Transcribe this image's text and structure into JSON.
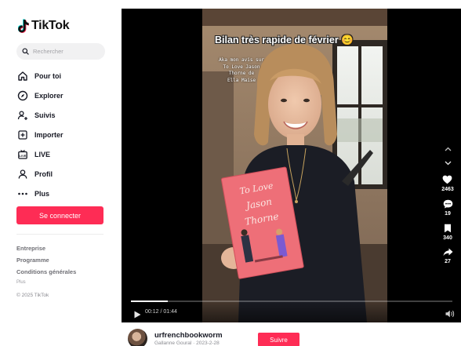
{
  "brand": {
    "name": "TikTok"
  },
  "search": {
    "placeholder": "Rechercher"
  },
  "nav": {
    "items": [
      {
        "label": "Pour toi",
        "icon": "home-icon"
      },
      {
        "label": "Explorer",
        "icon": "compass-icon"
      },
      {
        "label": "Suivis",
        "icon": "user-follow-icon"
      },
      {
        "label": "Importer",
        "icon": "upload-icon"
      },
      {
        "label": "LIVE",
        "icon": "live-tv-icon"
      },
      {
        "label": "Profil",
        "icon": "profile-icon"
      },
      {
        "label": "Plus",
        "icon": "more-icon"
      }
    ]
  },
  "sidebar": {
    "connect_label": "Se connecter",
    "footer": {
      "company": "Entreprise",
      "program": "Programme",
      "terms": "Conditions générales",
      "more": "Plus",
      "copyright": "© 2025 TikTok"
    }
  },
  "video": {
    "caption_title": "Bilan très rapide de février 😊",
    "caption_sub": "Aka mon avis sur\nTo Love Jason\nThorne de\nElla Maise",
    "book_title": "To Love Jason Thorne",
    "time": "00:12 / 01:44",
    "progress": 0.115
  },
  "actions": {
    "likes": "2463",
    "comments": "19",
    "saves": "340",
    "shares": "27"
  },
  "author": {
    "username": "urfrenchbookworm",
    "meta": "Gallanne Goural · 2023-2-28",
    "follow_label": "Suivre"
  },
  "colors": {
    "accent": "#fe2c55",
    "text": "#161823"
  }
}
